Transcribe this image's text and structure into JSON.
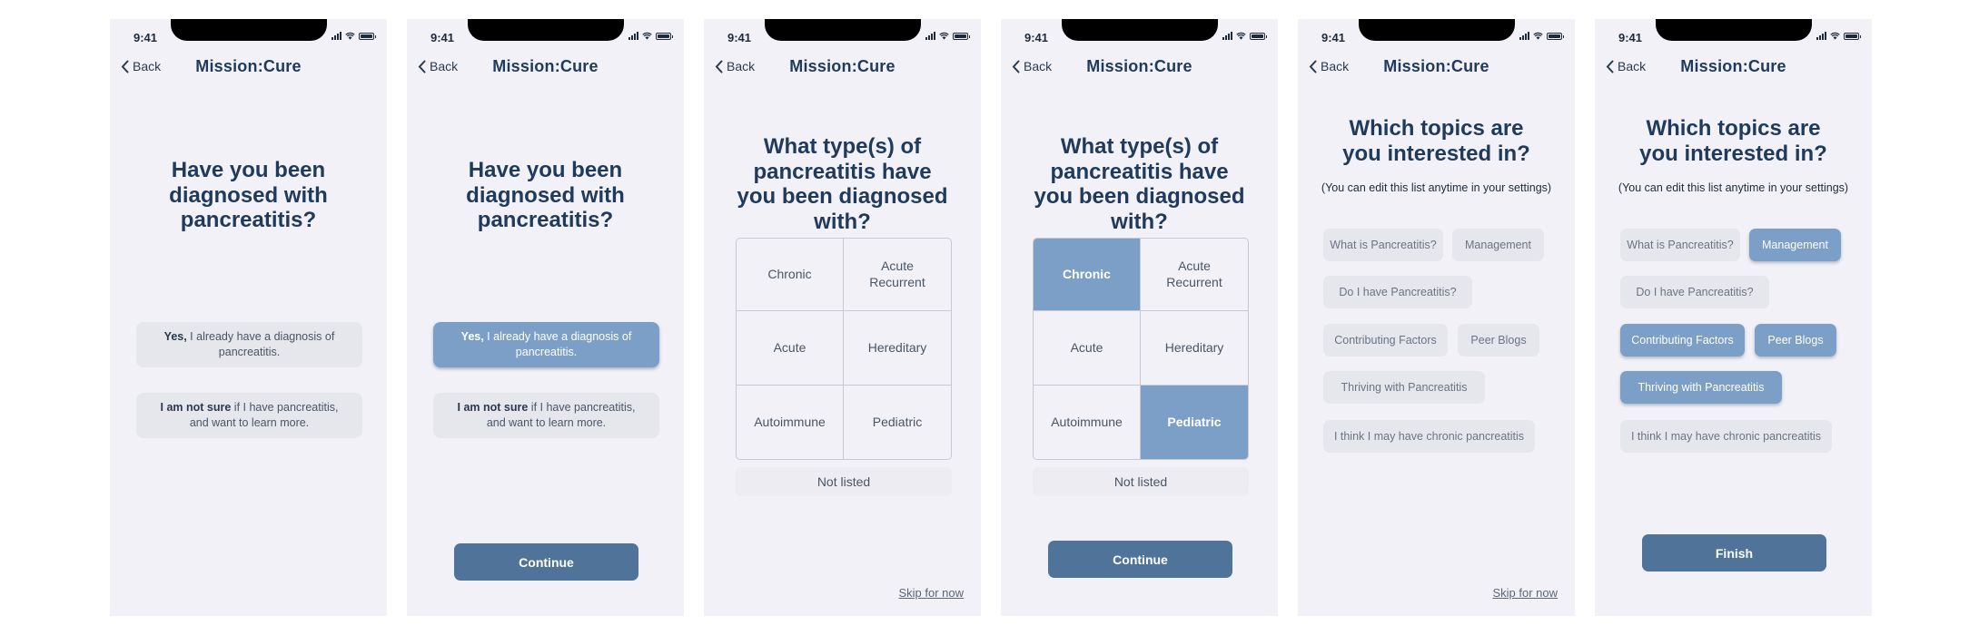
{
  "status": {
    "time": "9:41"
  },
  "nav": {
    "back_label": "Back",
    "brand": "Mission:Cure"
  },
  "screen1": {
    "title": "Have you been diagnosed with pancreatitis?",
    "yes_bold": "Yes,",
    "yes_text": " I already have a diagnosis of pancreatitis.",
    "notsure_bold": "I am not sure",
    "notsure_text": " if I have pancreatitis, and want to learn more."
  },
  "screen2": {
    "title": "Have you been diagnosed with pancreatitis?",
    "yes_bold": "Yes,",
    "yes_text": " I already have a diagnosis of pancreatitis.",
    "notsure_bold": "I am not sure",
    "notsure_text": " if I have pancreatitis, and want to learn more.",
    "continue_label": "Continue",
    "selected_option": "yes"
  },
  "screen3": {
    "title": "What type(s) of pancreatitis have you been diagnosed with?",
    "types": [
      "Chronic",
      "Acute Recurrent",
      "Acute",
      "Hereditary",
      "Autoimmune",
      "Pediatric"
    ],
    "not_listed": "Not listed",
    "skip_label": "Skip for now"
  },
  "screen4": {
    "title": "What type(s) of pancreatitis have you been diagnosed with?",
    "types": [
      "Chronic",
      "Acute Recurrent",
      "Acute",
      "Hereditary",
      "Autoimmune",
      "Pediatric"
    ],
    "selected_types": [
      "Chronic",
      "Pediatric"
    ],
    "not_listed": "Not listed",
    "continue_label": "Continue"
  },
  "screen5": {
    "title": "Which topics are you interested in?",
    "subtitle": "(You can edit this list anytime in your settings)",
    "topics": [
      "What is Pancreatitis?",
      "Management",
      "Do I have Pancreatitis?",
      "Contributing Factors",
      "Peer Blogs",
      "Thriving with Pancreatitis",
      "I think I may have chronic pancreatitis"
    ],
    "skip_label": "Skip for now"
  },
  "screen6": {
    "title": "Which topics are you interested in?",
    "subtitle": "(You can edit this list anytime in your settings)",
    "topics": [
      "What is Pancreatitis?",
      "Management",
      "Do I have Pancreatitis?",
      "Contributing Factors",
      "Peer Blogs",
      "Thriving with Pancreatitis",
      "I think I may have chronic pancreatitis"
    ],
    "selected_topics": [
      "Management",
      "Contributing Factors",
      "Peer Blogs",
      "Thriving with Pancreatitis"
    ],
    "finish_label": "Finish"
  },
  "colors": {
    "background": "#f1f1f7",
    "selected": "#7c9fc8",
    "primary_button": "#4f7399",
    "text": "#1f3a5a"
  },
  "icons": {
    "back": "chevron-left-icon",
    "signal": "cellular-signal-icon",
    "wifi": "wifi-icon",
    "battery": "battery-icon"
  }
}
